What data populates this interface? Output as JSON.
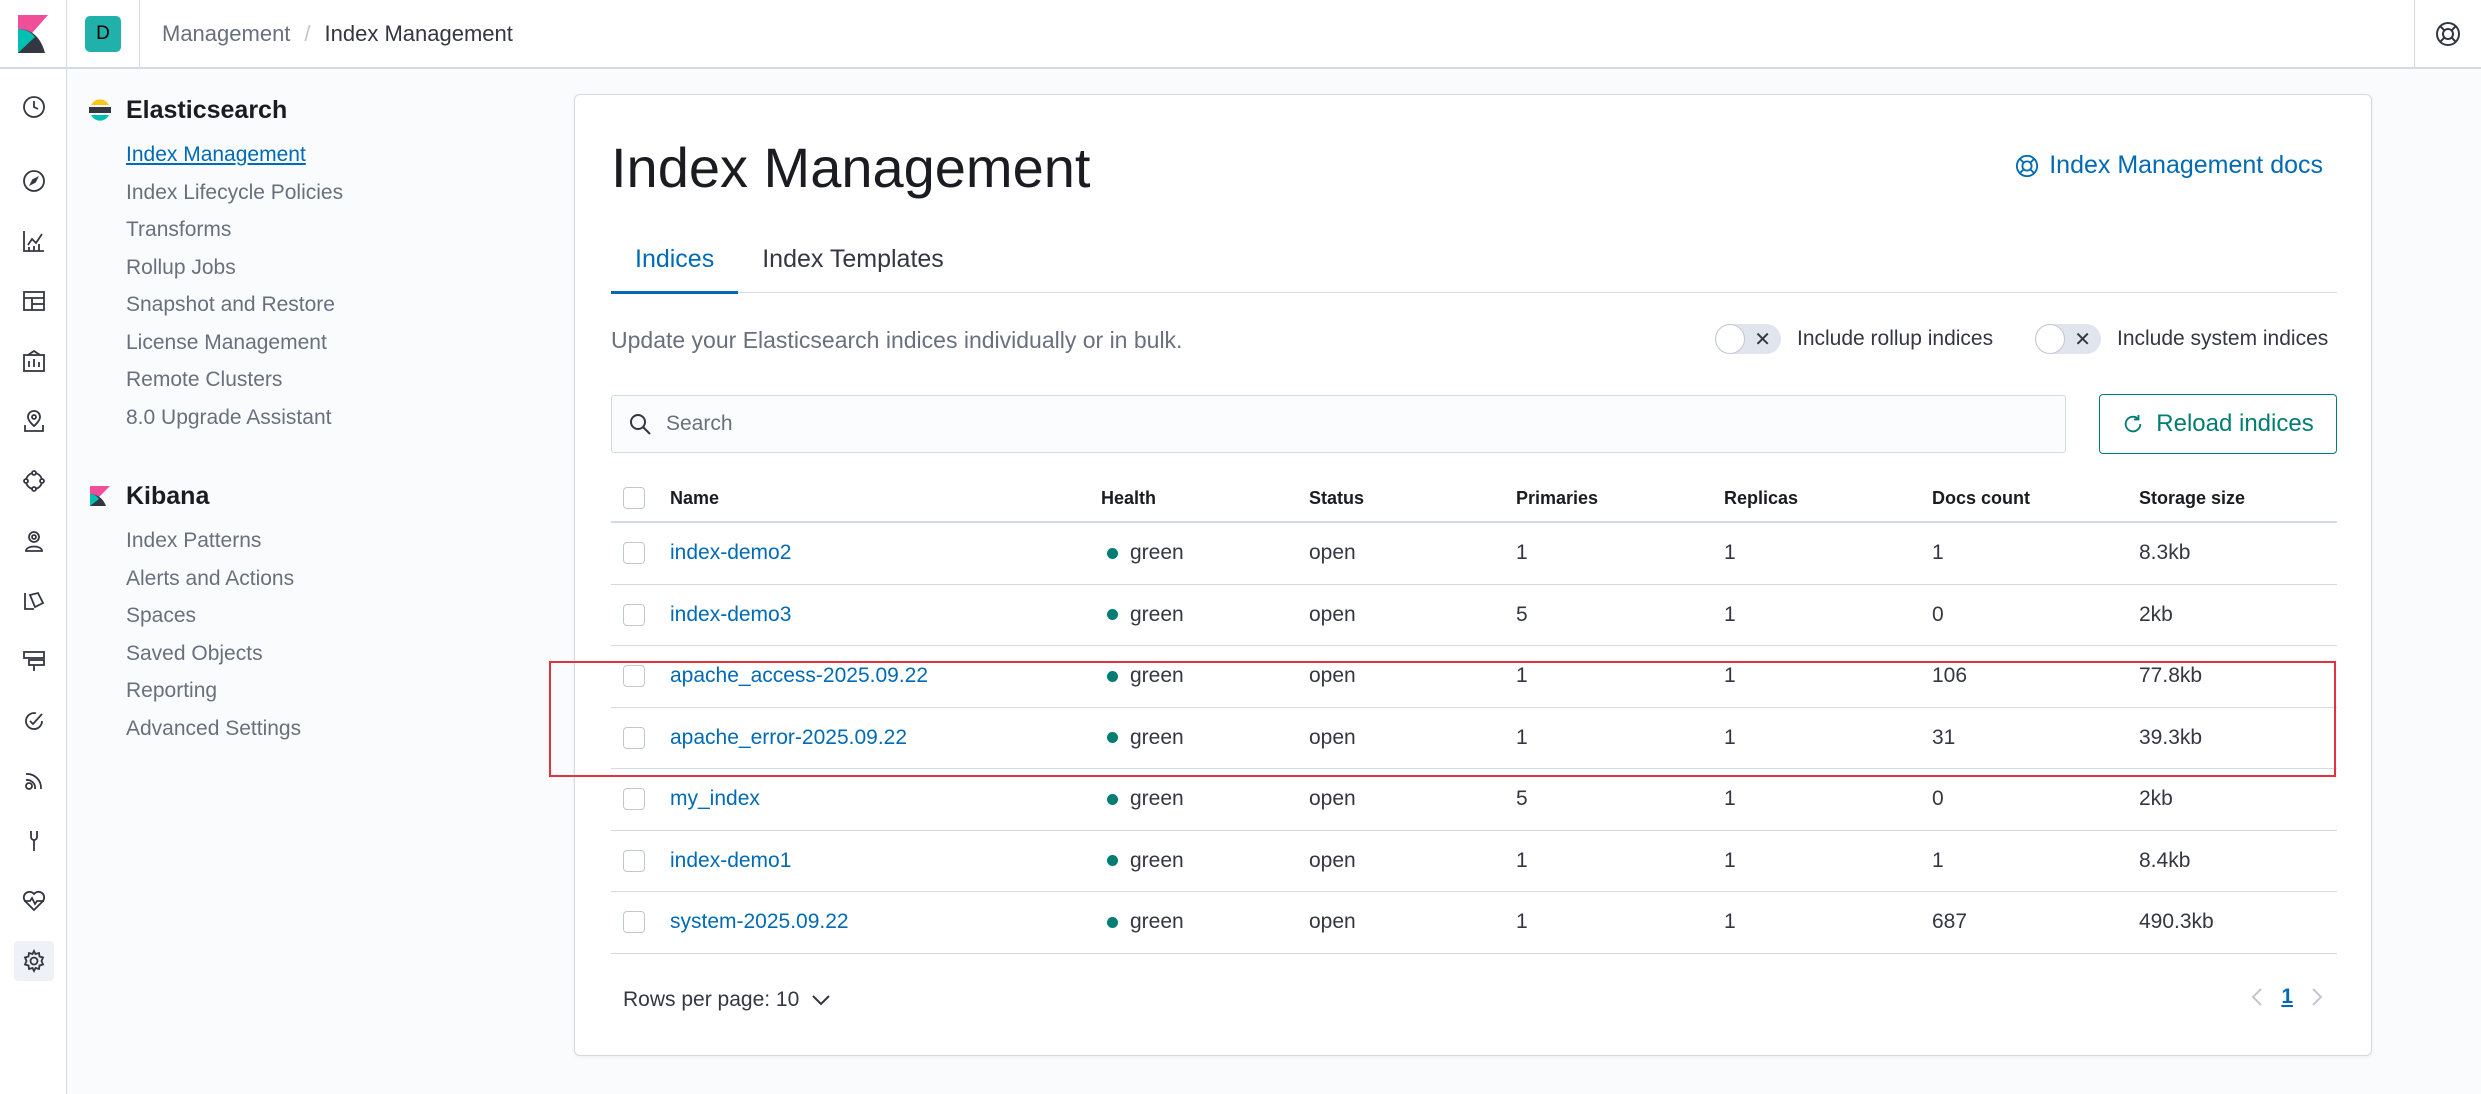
{
  "header": {
    "space_initial": "D",
    "breadcrumb": {
      "parent": "Management",
      "separator": "/",
      "current": "Index Management"
    }
  },
  "iconnav": {
    "icons": [
      "clock-icon",
      "compass-icon",
      "visualize-icon",
      "dashboard-icon",
      "canvas-icon",
      "maps-icon",
      "ml-icon",
      "graph-icon",
      "logs-icon",
      "apm-icon",
      "uptime-icon",
      "siem-icon",
      "devtools-icon",
      "monitoring-icon",
      "management-gear-icon"
    ]
  },
  "sidenav": {
    "elasticsearch": {
      "title": "Elasticsearch",
      "items": [
        "Index Management",
        "Index Lifecycle Policies",
        "Transforms",
        "Rollup Jobs",
        "Snapshot and Restore",
        "License Management",
        "Remote Clusters",
        "8.0 Upgrade Assistant"
      ]
    },
    "kibana": {
      "title": "Kibana",
      "items": [
        "Index Patterns",
        "Alerts and Actions",
        "Spaces",
        "Saved Objects",
        "Reporting",
        "Advanced Settings"
      ]
    }
  },
  "main": {
    "title": "Index Management",
    "docs_link": "Index Management docs",
    "tabs": [
      {
        "label": "Indices"
      },
      {
        "label": "Index Templates"
      }
    ],
    "description": "Update your Elasticsearch indices individually or in bulk.",
    "toggle_rollup": "Include rollup indices",
    "toggle_system": "Include system indices",
    "search_placeholder": "Search",
    "reload_label": "Reload indices"
  },
  "table": {
    "columns": [
      "Name",
      "Health",
      "Status",
      "Primaries",
      "Replicas",
      "Docs count",
      "Storage size"
    ],
    "rows": [
      {
        "name": "index-demo2",
        "health": "green",
        "status": "open",
        "primaries": "1",
        "replicas": "1",
        "docs": "1",
        "size": "8.3kb"
      },
      {
        "name": "index-demo3",
        "health": "green",
        "status": "open",
        "primaries": "5",
        "replicas": "1",
        "docs": "0",
        "size": "2kb"
      },
      {
        "name": "apache_access-2025.09.22",
        "health": "green",
        "status": "open",
        "primaries": "1",
        "replicas": "1",
        "docs": "106",
        "size": "77.8kb"
      },
      {
        "name": "apache_error-2025.09.22",
        "health": "green",
        "status": "open",
        "primaries": "1",
        "replicas": "1",
        "docs": "31",
        "size": "39.3kb"
      },
      {
        "name": "my_index",
        "health": "green",
        "status": "open",
        "primaries": "5",
        "replicas": "1",
        "docs": "0",
        "size": "2kb"
      },
      {
        "name": "index-demo1",
        "health": "green",
        "status": "open",
        "primaries": "1",
        "replicas": "1",
        "docs": "1",
        "size": "8.4kb"
      },
      {
        "name": "system-2025.09.22",
        "health": "green",
        "status": "open",
        "primaries": "1",
        "replicas": "1",
        "docs": "687",
        "size": "490.3kb"
      }
    ]
  },
  "pagination": {
    "rows_per_page": "Rows per page: 10",
    "current_page": "1"
  },
  "colors": {
    "link": "#006bb4",
    "health_green": "#017d73",
    "highlight": "#e0333f"
  }
}
